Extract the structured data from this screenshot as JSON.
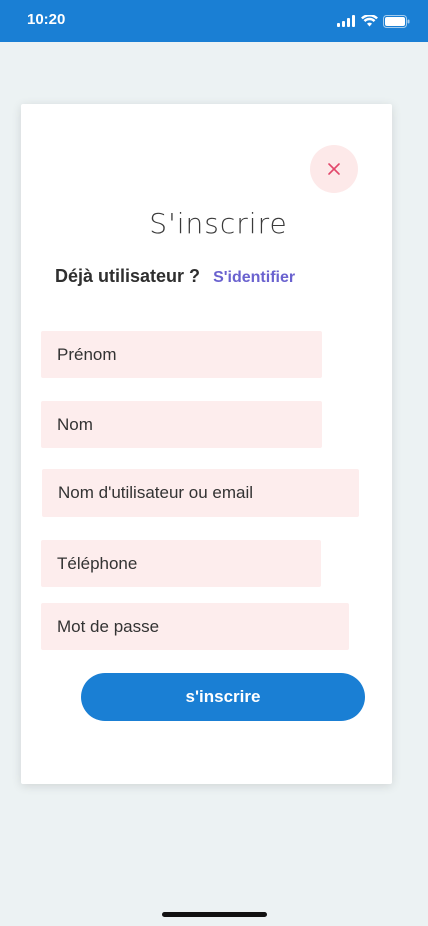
{
  "status_bar": {
    "time": "10:20",
    "icons": [
      "signal-icon",
      "wifi-icon",
      "battery-icon"
    ]
  },
  "dialog": {
    "close_icon": "close-icon",
    "title": "S'inscrire",
    "login_question": "Déjà utilisateur ?",
    "login_link": "S'identifier",
    "fields": [
      {
        "placeholder": "Prénom"
      },
      {
        "placeholder": "Nom"
      },
      {
        "placeholder": "Nom d'utilisateur ou email"
      },
      {
        "placeholder": "Téléphone"
      },
      {
        "placeholder": "Mot de passe"
      }
    ],
    "submit_label": "s'inscrire"
  },
  "colors": {
    "primary": "#1a7fd4",
    "field_bg": "#fdeded",
    "link": "#6a62cf",
    "close": "#e2476b",
    "background": "#ecf2f3"
  }
}
